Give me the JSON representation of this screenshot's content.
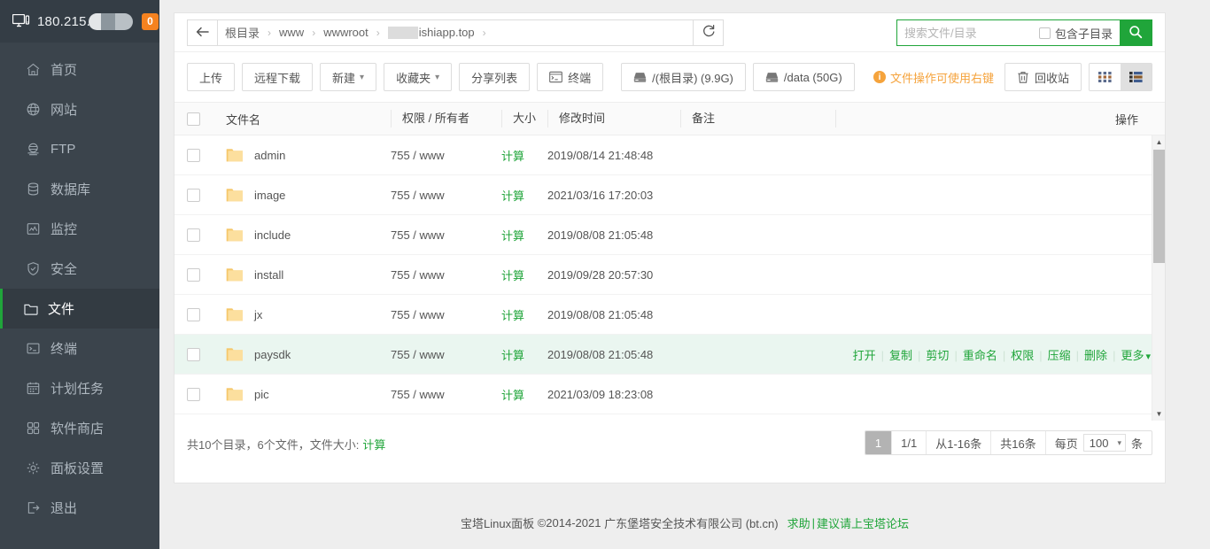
{
  "sidebar": {
    "header": {
      "ip": "180.215.",
      "ip_masked": true,
      "badge": "0",
      "icon": "monitor-icon"
    },
    "items": [
      {
        "label": "首页",
        "icon": "home-icon",
        "active": false
      },
      {
        "label": "网站",
        "icon": "globe-icon",
        "active": false
      },
      {
        "label": "FTP",
        "icon": "ftp-icon",
        "active": false
      },
      {
        "label": "数据库",
        "icon": "database-icon",
        "active": false
      },
      {
        "label": "监控",
        "icon": "monitor-chart-icon",
        "active": false
      },
      {
        "label": "安全",
        "icon": "shield-icon",
        "active": false
      },
      {
        "label": "文件",
        "icon": "folder-icon",
        "active": true
      },
      {
        "label": "终端",
        "icon": "terminal-icon",
        "active": false
      },
      {
        "label": "计划任务",
        "icon": "calendar-icon",
        "active": false
      },
      {
        "label": "软件商店",
        "icon": "grid-icon",
        "active": false
      },
      {
        "label": "面板设置",
        "icon": "gear-icon",
        "active": false
      },
      {
        "label": "退出",
        "icon": "logout-icon",
        "active": false
      }
    ]
  },
  "pathbar": {
    "back_icon": "arrow-left-icon",
    "refresh_icon": "refresh-icon",
    "crumbs": [
      {
        "label": "根目录",
        "masked": false
      },
      {
        "label": "www",
        "masked": false
      },
      {
        "label": "wwwroot",
        "masked": false
      },
      {
        "label": "ishiapp.top",
        "masked": true
      }
    ],
    "separator": "›"
  },
  "search": {
    "placeholder": "搜索文件/目录",
    "value": "",
    "subdir_label": "包含子目录",
    "subdir_checked": false,
    "button_icon": "search-icon",
    "accent": "#20a53a"
  },
  "toolbar": {
    "buttons": [
      {
        "label": "上传",
        "icon": null,
        "caret": false
      },
      {
        "label": "远程下载",
        "icon": null,
        "caret": false
      },
      {
        "label": "新建",
        "icon": null,
        "caret": true
      },
      {
        "label": "收藏夹",
        "icon": null,
        "caret": true
      },
      {
        "label": "分享列表",
        "icon": null,
        "caret": false
      },
      {
        "label": "终端",
        "icon": "terminal-icon",
        "caret": false
      }
    ],
    "disks": [
      {
        "label": "/(根目录) (9.9G)",
        "icon": "disk-icon"
      },
      {
        "label": "/data (50G)",
        "icon": "disk-icon"
      }
    ],
    "hint": "文件操作可使用右键",
    "hint_icon": "info-icon",
    "hint_color": "#f5a33c",
    "recycle": {
      "label": "回收站",
      "icon": "trash-icon"
    },
    "view": {
      "grid_icon": "grid-view-icon",
      "list_icon": "list-view-icon",
      "selected": "list"
    }
  },
  "table": {
    "headers": {
      "checkbox": "",
      "name": "文件名",
      "perm": "权限 / 所有者",
      "size": "大小",
      "time": "修改时间",
      "note": "备注",
      "ops": "操作"
    },
    "rows": [
      {
        "name": "admin",
        "icon": "folder-icon",
        "perm": "755 / www",
        "size": "计算",
        "time": "2019/08/14 21:48:48",
        "note": "",
        "hover": false
      },
      {
        "name": "image",
        "icon": "folder-icon",
        "perm": "755 / www",
        "size": "计算",
        "time": "2021/03/16 17:20:03",
        "note": "",
        "hover": false
      },
      {
        "name": "include",
        "icon": "folder-icon",
        "perm": "755 / www",
        "size": "计算",
        "time": "2019/08/08 21:05:48",
        "note": "",
        "hover": false
      },
      {
        "name": "install",
        "icon": "folder-icon",
        "perm": "755 / www",
        "size": "计算",
        "time": "2019/09/28 20:57:30",
        "note": "",
        "hover": false
      },
      {
        "name": "jx",
        "icon": "folder-icon",
        "perm": "755 / www",
        "size": "计算",
        "time": "2019/08/08 21:05:48",
        "note": "",
        "hover": false
      },
      {
        "name": "paysdk",
        "icon": "folder-icon",
        "perm": "755 / www",
        "size": "计算",
        "time": "2019/08/08 21:05:48",
        "note": "",
        "hover": true
      },
      {
        "name": "pic",
        "icon": "folder-icon",
        "perm": "755 / www",
        "size": "计算",
        "time": "2021/03/09 18:23:08",
        "note": "",
        "hover": false
      }
    ],
    "row_ops": [
      "打开",
      "复制",
      "剪切",
      "重命名",
      "权限",
      "压缩",
      "删除",
      "更多"
    ],
    "row_ops_caret": "∨"
  },
  "summary": {
    "prefix": "共10个目录，6个文件，文件大小:",
    "calc_link": "计算"
  },
  "pager": {
    "current_page": "1",
    "page_of": "1/1",
    "range": "从1-16条",
    "total": "共16条",
    "per_page_label": "每页",
    "per_page_value": "100",
    "per_page_unit": "条"
  },
  "footer": {
    "product": "宝塔Linux面板",
    "copyright": "©2014-2021",
    "company": "广东堡塔安全技术有限公司 (bt.cn)",
    "link_help": "求助",
    "link_sep": "|",
    "link_forum": "建议请上宝塔论坛"
  }
}
